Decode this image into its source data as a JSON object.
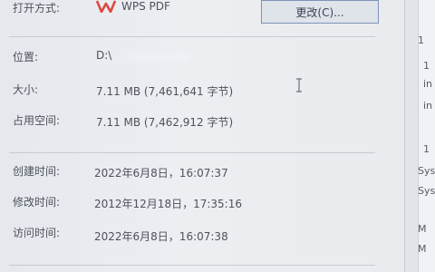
{
  "open_with": {
    "label": "打开方式:",
    "app": "WPS PDF",
    "change_button": "更改(C)..."
  },
  "location": {
    "label": "位置:",
    "value": "D:\\"
  },
  "size": {
    "label": "大小:",
    "value": "7.11 MB (7,461,641 字节)"
  },
  "size_on_disk": {
    "label": "占用空间:",
    "value": "7.11 MB (7,462,912 字节)"
  },
  "created": {
    "label": "创建时间:",
    "value": "2022年6月8日，16:07:37"
  },
  "modified": {
    "label": "修改时间:",
    "value": "2012年12月18日，17:35:16"
  },
  "accessed": {
    "label": "访问时间:",
    "value": "2022年6月8日，16:07:38"
  },
  "side_panel": [
    "1",
    "in",
    "in",
    "1",
    "Sys",
    "Sys",
    "M",
    "M"
  ],
  "colors": {
    "wps_red": "#e0473f",
    "button_border": "#7c93b7"
  }
}
